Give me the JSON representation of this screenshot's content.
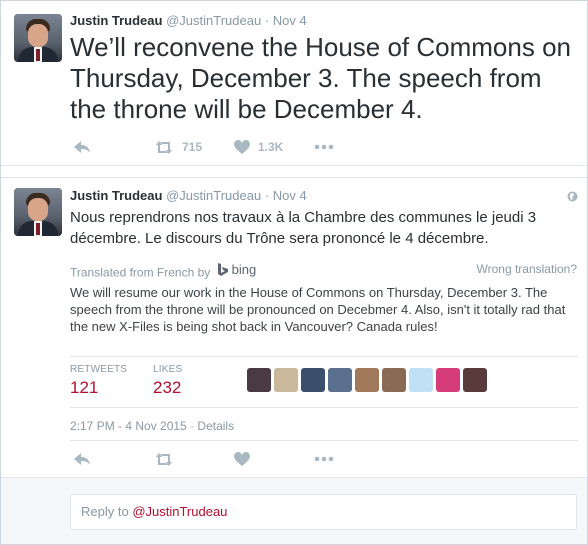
{
  "tweet1": {
    "author_name": "Justin Trudeau",
    "handle": "@JustinTrudeau",
    "separator": "·",
    "date": "Nov 4",
    "text": "We’ll reconvene the House of Commons on Thursday, December 3. The speech from the throne will be December 4.",
    "retweets": "715",
    "likes": "1.3K"
  },
  "tweet2": {
    "author_name": "Justin Trudeau",
    "handle": "@JustinTrudeau",
    "separator": "·",
    "date": "Nov 4",
    "text": "Nous reprendrons nos travaux à la Chambre des communes le jeudi 3 décembre. Le discours du Trône sera prononcé le 4 décembre.",
    "translated_from": "Translated from French by",
    "translator": "bing",
    "wrong_translation": "Wrong translation?",
    "translation": "We will resume our work in the House of Commons on Thursday, December 3. The speech from the throne will be pronounced on Decebmer 4. Also, isn't it totally rad that the new X-Files is being shot back in Vancouver? Canada rules!",
    "retweets_label": "RETWEETS",
    "retweets_value": "121",
    "likes_label": "LIKES",
    "likes_value": "232",
    "timestamp": "2:17 PM - 4 Nov 2015",
    "details_separator": " · ",
    "details": "Details"
  },
  "reply": {
    "prefix": "Reply to ",
    "handle": "@JustinTrudeau"
  },
  "colors": {
    "link": "#b2102f",
    "muted": "#8899a6",
    "icon": "#aab8c2"
  },
  "icons": [
    "reply-icon",
    "retweet-icon",
    "like-icon",
    "more-icon",
    "globe-icon",
    "bing-logo-icon"
  ]
}
